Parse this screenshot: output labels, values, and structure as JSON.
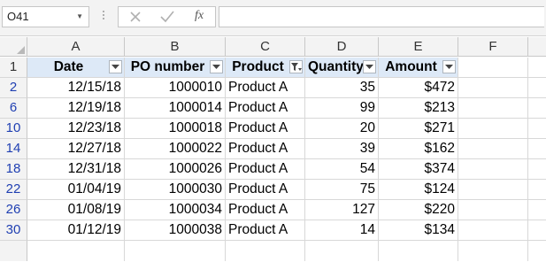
{
  "name_box": {
    "value": "O41"
  },
  "formula_bar": {
    "fx_label": "fx",
    "content": ""
  },
  "columns": [
    "A",
    "B",
    "C",
    "D",
    "E",
    "F"
  ],
  "row_numbers": [
    "1",
    "2",
    "6",
    "10",
    "14",
    "18",
    "22",
    "26",
    "30",
    ""
  ],
  "header": {
    "date": "Date",
    "po_number": "PO number",
    "product": "Product",
    "quantity": "Quantity",
    "amount": "Amount",
    "product_filter_active": true
  },
  "rows": [
    {
      "date": "12/15/18",
      "po": "1000010",
      "product": "Product A",
      "qty": "35",
      "amount": "$472"
    },
    {
      "date": "12/19/18",
      "po": "1000014",
      "product": "Product A",
      "qty": "99",
      "amount": "$213"
    },
    {
      "date": "12/23/18",
      "po": "1000018",
      "product": "Product A",
      "qty": "20",
      "amount": "$271"
    },
    {
      "date": "12/27/18",
      "po": "1000022",
      "product": "Product A",
      "qty": "39",
      "amount": "$162"
    },
    {
      "date": "12/31/18",
      "po": "1000026",
      "product": "Product A",
      "qty": "54",
      "amount": "$374"
    },
    {
      "date": "01/04/19",
      "po": "1000030",
      "product": "Product A",
      "qty": "75",
      "amount": "$124"
    },
    {
      "date": "01/08/19",
      "po": "1000034",
      "product": "Product A",
      "qty": "127",
      "amount": "$220"
    },
    {
      "date": "01/12/19",
      "po": "1000038",
      "product": "Product A",
      "qty": "14",
      "amount": "$134"
    }
  ],
  "colors": {
    "header_fill": "#dde9f7",
    "filtered_row_number": "#1f3fb2",
    "gridline": "#d8d8d8"
  }
}
